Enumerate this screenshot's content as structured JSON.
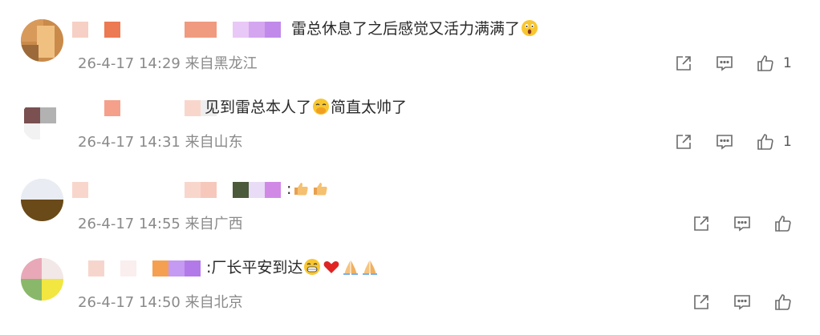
{
  "comments": [
    {
      "text": "雷总休息了之后感觉又活力满满了",
      "emoji": [
        "astonished-face"
      ],
      "time": "26-4-17 14:29",
      "location": "来自黑龙江",
      "likes": "1"
    },
    {
      "text_a": "见到雷总本人了",
      "emoji_mid": [
        "hand-over-mouth-face"
      ],
      "text_b": "简直太帅了",
      "time": "26-4-17 14:31",
      "location": "来自山东",
      "likes": "1"
    },
    {
      "text": ":",
      "emoji": [
        "thumbs-up",
        "thumbs-up"
      ],
      "time": "26-4-17 14:55",
      "location": "来自广西",
      "likes": ""
    },
    {
      "text": ":厂长平安到达",
      "emoji": [
        "grinning-face",
        "red-heart",
        "folded-hands",
        "folded-hands"
      ],
      "time": "26-4-17 14:50",
      "location": "来自北京",
      "likes": ""
    }
  ],
  "icons": {
    "share": "share-icon",
    "reply": "comment-icon",
    "like": "thumbs-up-icon"
  },
  "colors": {
    "meta": "#8a8a8a",
    "text": "#2a2a2a",
    "icon": "#6b6b6b"
  }
}
